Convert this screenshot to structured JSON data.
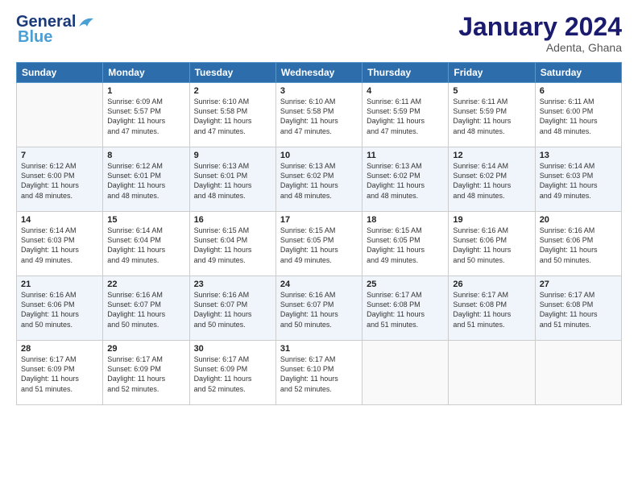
{
  "header": {
    "logo_line1": "General",
    "logo_line2": "Blue",
    "month_title": "January 2024",
    "location": "Adenta, Ghana"
  },
  "weekdays": [
    "Sunday",
    "Monday",
    "Tuesday",
    "Wednesday",
    "Thursday",
    "Friday",
    "Saturday"
  ],
  "weeks": [
    [
      {
        "num": "",
        "info": ""
      },
      {
        "num": "1",
        "info": "Sunrise: 6:09 AM\nSunset: 5:57 PM\nDaylight: 11 hours\nand 47 minutes."
      },
      {
        "num": "2",
        "info": "Sunrise: 6:10 AM\nSunset: 5:58 PM\nDaylight: 11 hours\nand 47 minutes."
      },
      {
        "num": "3",
        "info": "Sunrise: 6:10 AM\nSunset: 5:58 PM\nDaylight: 11 hours\nand 47 minutes."
      },
      {
        "num": "4",
        "info": "Sunrise: 6:11 AM\nSunset: 5:59 PM\nDaylight: 11 hours\nand 47 minutes."
      },
      {
        "num": "5",
        "info": "Sunrise: 6:11 AM\nSunset: 5:59 PM\nDaylight: 11 hours\nand 48 minutes."
      },
      {
        "num": "6",
        "info": "Sunrise: 6:11 AM\nSunset: 6:00 PM\nDaylight: 11 hours\nand 48 minutes."
      }
    ],
    [
      {
        "num": "7",
        "info": "Sunrise: 6:12 AM\nSunset: 6:00 PM\nDaylight: 11 hours\nand 48 minutes."
      },
      {
        "num": "8",
        "info": "Sunrise: 6:12 AM\nSunset: 6:01 PM\nDaylight: 11 hours\nand 48 minutes."
      },
      {
        "num": "9",
        "info": "Sunrise: 6:13 AM\nSunset: 6:01 PM\nDaylight: 11 hours\nand 48 minutes."
      },
      {
        "num": "10",
        "info": "Sunrise: 6:13 AM\nSunset: 6:02 PM\nDaylight: 11 hours\nand 48 minutes."
      },
      {
        "num": "11",
        "info": "Sunrise: 6:13 AM\nSunset: 6:02 PM\nDaylight: 11 hours\nand 48 minutes."
      },
      {
        "num": "12",
        "info": "Sunrise: 6:14 AM\nSunset: 6:02 PM\nDaylight: 11 hours\nand 48 minutes."
      },
      {
        "num": "13",
        "info": "Sunrise: 6:14 AM\nSunset: 6:03 PM\nDaylight: 11 hours\nand 49 minutes."
      }
    ],
    [
      {
        "num": "14",
        "info": "Sunrise: 6:14 AM\nSunset: 6:03 PM\nDaylight: 11 hours\nand 49 minutes."
      },
      {
        "num": "15",
        "info": "Sunrise: 6:14 AM\nSunset: 6:04 PM\nDaylight: 11 hours\nand 49 minutes."
      },
      {
        "num": "16",
        "info": "Sunrise: 6:15 AM\nSunset: 6:04 PM\nDaylight: 11 hours\nand 49 minutes."
      },
      {
        "num": "17",
        "info": "Sunrise: 6:15 AM\nSunset: 6:05 PM\nDaylight: 11 hours\nand 49 minutes."
      },
      {
        "num": "18",
        "info": "Sunrise: 6:15 AM\nSunset: 6:05 PM\nDaylight: 11 hours\nand 49 minutes."
      },
      {
        "num": "19",
        "info": "Sunrise: 6:16 AM\nSunset: 6:06 PM\nDaylight: 11 hours\nand 50 minutes."
      },
      {
        "num": "20",
        "info": "Sunrise: 6:16 AM\nSunset: 6:06 PM\nDaylight: 11 hours\nand 50 minutes."
      }
    ],
    [
      {
        "num": "21",
        "info": "Sunrise: 6:16 AM\nSunset: 6:06 PM\nDaylight: 11 hours\nand 50 minutes."
      },
      {
        "num": "22",
        "info": "Sunrise: 6:16 AM\nSunset: 6:07 PM\nDaylight: 11 hours\nand 50 minutes."
      },
      {
        "num": "23",
        "info": "Sunrise: 6:16 AM\nSunset: 6:07 PM\nDaylight: 11 hours\nand 50 minutes."
      },
      {
        "num": "24",
        "info": "Sunrise: 6:16 AM\nSunset: 6:07 PM\nDaylight: 11 hours\nand 50 minutes."
      },
      {
        "num": "25",
        "info": "Sunrise: 6:17 AM\nSunset: 6:08 PM\nDaylight: 11 hours\nand 51 minutes."
      },
      {
        "num": "26",
        "info": "Sunrise: 6:17 AM\nSunset: 6:08 PM\nDaylight: 11 hours\nand 51 minutes."
      },
      {
        "num": "27",
        "info": "Sunrise: 6:17 AM\nSunset: 6:08 PM\nDaylight: 11 hours\nand 51 minutes."
      }
    ],
    [
      {
        "num": "28",
        "info": "Sunrise: 6:17 AM\nSunset: 6:09 PM\nDaylight: 11 hours\nand 51 minutes."
      },
      {
        "num": "29",
        "info": "Sunrise: 6:17 AM\nSunset: 6:09 PM\nDaylight: 11 hours\nand 52 minutes."
      },
      {
        "num": "30",
        "info": "Sunrise: 6:17 AM\nSunset: 6:09 PM\nDaylight: 11 hours\nand 52 minutes."
      },
      {
        "num": "31",
        "info": "Sunrise: 6:17 AM\nSunset: 6:10 PM\nDaylight: 11 hours\nand 52 minutes."
      },
      {
        "num": "",
        "info": ""
      },
      {
        "num": "",
        "info": ""
      },
      {
        "num": "",
        "info": ""
      }
    ]
  ]
}
